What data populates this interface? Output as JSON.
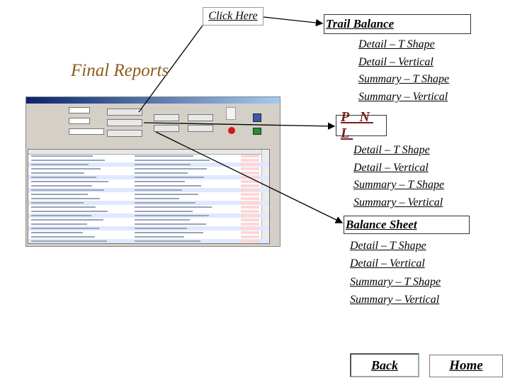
{
  "click_here": "Click Here",
  "final_reports": "Final Reports",
  "trail_balance": {
    "title": "Trail Balance",
    "options": [
      "Detail – T Shape",
      "Detail – Vertical",
      "Summary – T Shape",
      "Summary – Vertical"
    ]
  },
  "pnl": {
    "title": "P N L",
    "options": [
      "Detail – T Shape",
      "Detail – Vertical",
      "Summary – T Shape",
      "Summary – Vertical"
    ]
  },
  "balance_sheet": {
    "title": "Balance Sheet",
    "options": [
      "Detail – T Shape",
      "Detail – Vertical",
      "Summary – T Shape",
      "Summary – Vertical"
    ]
  },
  "nav": {
    "back": "Back",
    "home": "Home"
  },
  "colors": {
    "final_reports": "#8b5a1c",
    "pnl_title": "#7a1f1f"
  }
}
